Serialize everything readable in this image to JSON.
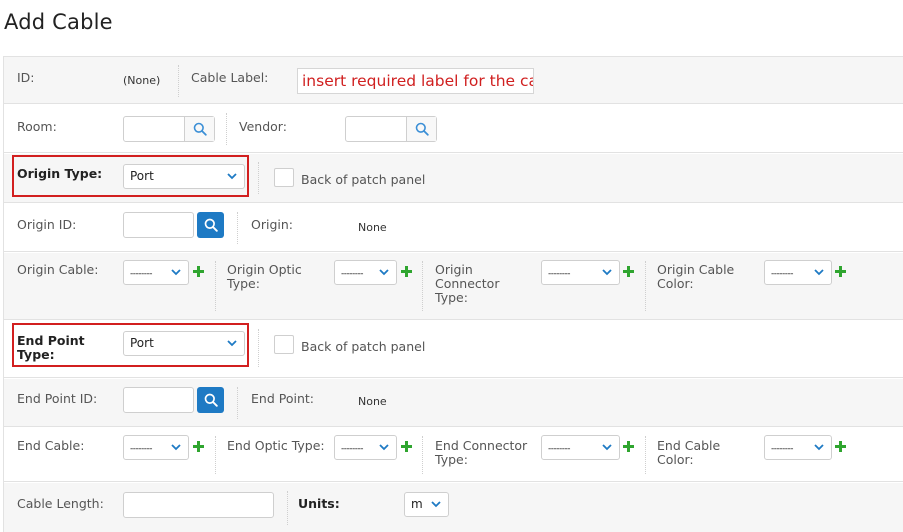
{
  "page": {
    "title": "Add Cable"
  },
  "row_id": {
    "id_label": "ID:",
    "id_value": "(None)",
    "cable_label_label": "Cable Label:",
    "cable_label_value": "insert required label for the cable"
  },
  "row_room": {
    "room_label": "Room:",
    "vendor_label": "Vendor:"
  },
  "row_origin_type": {
    "label": "Origin Type:",
    "selected": "Port",
    "back_label": "Back of patch panel"
  },
  "row_origin_id": {
    "label": "Origin ID:",
    "origin_label": "Origin:",
    "origin_value": "None"
  },
  "row_origin_cable": {
    "cable_label": "Origin Cable:",
    "cable_selected": "--------",
    "optic_label": "Origin Optic Type:",
    "optic_selected": "--------",
    "connector_label": "Origin Connector Type:",
    "connector_selected": "--------",
    "color_label": "Origin Cable Color:",
    "color_selected": "--------"
  },
  "row_end_type": {
    "label": "End Point Type:",
    "selected": "Port",
    "back_label": "Back of patch panel"
  },
  "row_end_id": {
    "label": "End Point ID:",
    "end_label": "End Point:",
    "end_value": "None"
  },
  "row_end_cable": {
    "cable_label": "End Cable:",
    "cable_selected": "--------",
    "optic_label": "End Optic Type:",
    "optic_selected": "--------",
    "connector_label": "End Connector Type:",
    "connector_selected": "--------",
    "color_label": "End Cable Color:",
    "color_selected": "--------"
  },
  "row_length": {
    "length_label": "Cable Length:",
    "units_label": "Units:",
    "units_selected": "m"
  },
  "colors": {
    "accent": "#1e7ac4",
    "highlight": "#d21f1f",
    "plus": "#2fa52f",
    "label_text": "#d02020"
  }
}
